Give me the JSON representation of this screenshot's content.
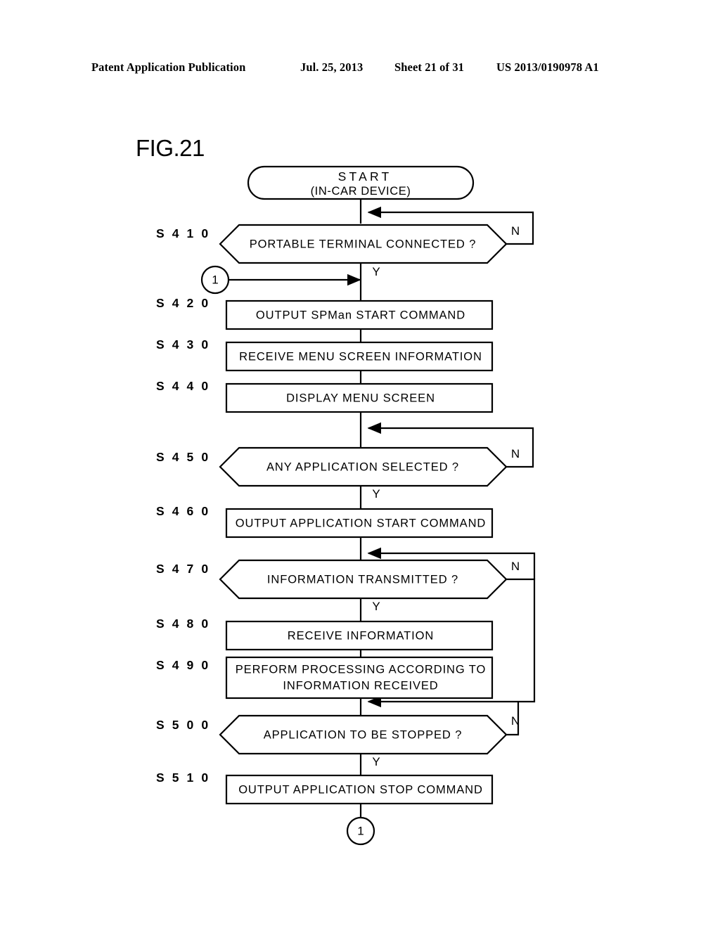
{
  "header": {
    "publication": "Patent Application Publication",
    "date": "Jul. 25, 2013",
    "sheet": "Sheet 21 of 31",
    "patent_number": "US 2013/0190978 A1"
  },
  "figure": {
    "label": "FIG.21",
    "start_node": {
      "title": "START",
      "subtitle": "(IN-CAR DEVICE)"
    },
    "connector_in_label": "1",
    "connector_out_label": "1",
    "yes_label": "Y",
    "no_label": "N",
    "stroke_color": "#000000",
    "fill_color": "#ffffff"
  },
  "chart_data": {
    "type": "diagram",
    "title": "FIG.21",
    "diagram_kind": "flowchart",
    "nodes": [
      {
        "id": "start",
        "step": "",
        "kind": "terminator",
        "text": "START (IN-CAR DEVICE)"
      },
      {
        "id": "s410",
        "step": "S 4 1 0",
        "kind": "decision",
        "text": "PORTABLE TERMINAL CONNECTED ?"
      },
      {
        "id": "s420",
        "step": "S 4 2 0",
        "kind": "process",
        "text": "OUTPUT SPMan START COMMAND"
      },
      {
        "id": "s430",
        "step": "S 4 3 0",
        "kind": "process",
        "text": "RECEIVE MENU SCREEN INFORMATION"
      },
      {
        "id": "s440",
        "step": "S 4 4 0",
        "kind": "process",
        "text": "DISPLAY MENU SCREEN"
      },
      {
        "id": "s450",
        "step": "S 4 5 0",
        "kind": "decision",
        "text": "ANY APPLICATION SELECTED ?"
      },
      {
        "id": "s460",
        "step": "S 4 6 0",
        "kind": "process",
        "text": "OUTPUT APPLICATION START COMMAND"
      },
      {
        "id": "s470",
        "step": "S 4 7 0",
        "kind": "decision",
        "text": "INFORMATION TRANSMITTED ?"
      },
      {
        "id": "s480",
        "step": "S 4 8 0",
        "kind": "process",
        "text": "RECEIVE INFORMATION"
      },
      {
        "id": "s490",
        "step": "S 4 9 0",
        "kind": "process",
        "text": "PERFORM PROCESSING ACCORDING TO INFORMATION RECEIVED"
      },
      {
        "id": "s500",
        "step": "S 5 0 0",
        "kind": "decision",
        "text": "APPLICATION TO BE STOPPED ?"
      },
      {
        "id": "s510",
        "step": "S 5 1 0",
        "kind": "process",
        "text": "OUTPUT APPLICATION STOP COMMAND"
      },
      {
        "id": "conn_1",
        "step": "",
        "kind": "connector",
        "text": "1"
      }
    ],
    "edges": [
      {
        "from": "start",
        "to": "s410",
        "label": ""
      },
      {
        "from": "s410",
        "to": "s410",
        "label": "N"
      },
      {
        "from": "s410",
        "to": "s420",
        "label": "Y"
      },
      {
        "from": "conn_1",
        "to": "s420",
        "label": ""
      },
      {
        "from": "s420",
        "to": "s430",
        "label": ""
      },
      {
        "from": "s430",
        "to": "s440",
        "label": ""
      },
      {
        "from": "s440",
        "to": "s450",
        "label": ""
      },
      {
        "from": "s450",
        "to": "s450",
        "label": "N"
      },
      {
        "from": "s450",
        "to": "s460",
        "label": "Y"
      },
      {
        "from": "s460",
        "to": "s470",
        "label": ""
      },
      {
        "from": "s470",
        "to": "s500",
        "label": "N"
      },
      {
        "from": "s470",
        "to": "s480",
        "label": "Y"
      },
      {
        "from": "s480",
        "to": "s490",
        "label": ""
      },
      {
        "from": "s490",
        "to": "s500",
        "label": ""
      },
      {
        "from": "s500",
        "to": "s500",
        "label": "N"
      },
      {
        "from": "s500",
        "to": "s510",
        "label": "Y"
      },
      {
        "from": "s510",
        "to": "conn_1",
        "label": ""
      }
    ]
  },
  "steps": {
    "s410": {
      "label": "S 4 1 0",
      "text": "PORTABLE TERMINAL CONNECTED ?"
    },
    "s420": {
      "label": "S 4 2 0",
      "text": "OUTPUT SPMan START COMMAND"
    },
    "s430": {
      "label": "S 4 3 0",
      "text": "RECEIVE MENU SCREEN INFORMATION"
    },
    "s440": {
      "label": "S 4 4 0",
      "text": "DISPLAY MENU SCREEN"
    },
    "s450": {
      "label": "S 4 5 0",
      "text": "ANY APPLICATION SELECTED ?"
    },
    "s460": {
      "label": "S 4 6 0",
      "text": "OUTPUT APPLICATION START COMMAND"
    },
    "s470": {
      "label": "S 4 7 0",
      "text": "INFORMATION TRANSMITTED ?"
    },
    "s480": {
      "label": "S 4 8 0",
      "text": "RECEIVE INFORMATION"
    },
    "s490": {
      "label": "S 4 9 0",
      "text_line1": "PERFORM PROCESSING ACCORDING TO",
      "text_line2": "INFORMATION RECEIVED"
    },
    "s500": {
      "label": "S 5 0 0",
      "text": "APPLICATION TO BE STOPPED ?"
    },
    "s510": {
      "label": "S 5 1 0",
      "text": "OUTPUT APPLICATION STOP COMMAND"
    }
  },
  "branch_labels": {
    "s410_n": "N",
    "s410_y": "Y",
    "s450_n": "N",
    "s450_y": "Y",
    "s470_n": "N",
    "s470_y": "Y",
    "s500_n": "N",
    "s500_y": "Y"
  }
}
